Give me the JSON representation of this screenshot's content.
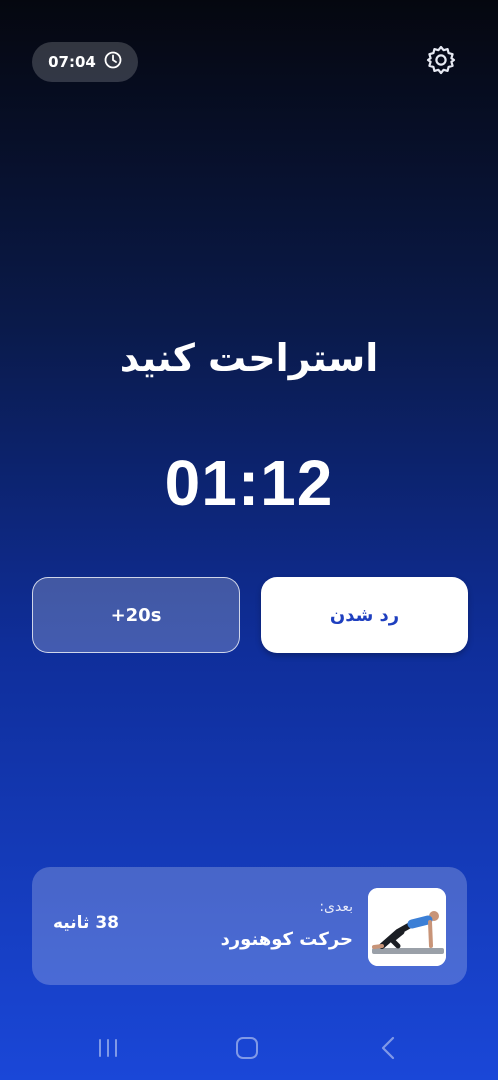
{
  "status": {
    "elapsed_time": "07:04",
    "clock_icon": "clock-icon",
    "settings_icon": "gear-icon"
  },
  "main": {
    "title": "استراحت کنید",
    "countdown": "01:12"
  },
  "actions": {
    "add_time_label": "+20s",
    "skip_label": "رد شدن"
  },
  "next_exercise": {
    "label": "بعدی:",
    "name": "حرکت کوهنورد",
    "duration": "38 ثانیه",
    "thumbnail_icon": "exercise-thumbnail"
  },
  "navigation": {
    "recent_icon": "recent-apps-icon",
    "home_icon": "home-icon",
    "back_icon": "back-icon"
  },
  "colors": {
    "accent": "#1e3fbf",
    "background_top": "#05070f",
    "background_bottom": "#1a47d8"
  }
}
